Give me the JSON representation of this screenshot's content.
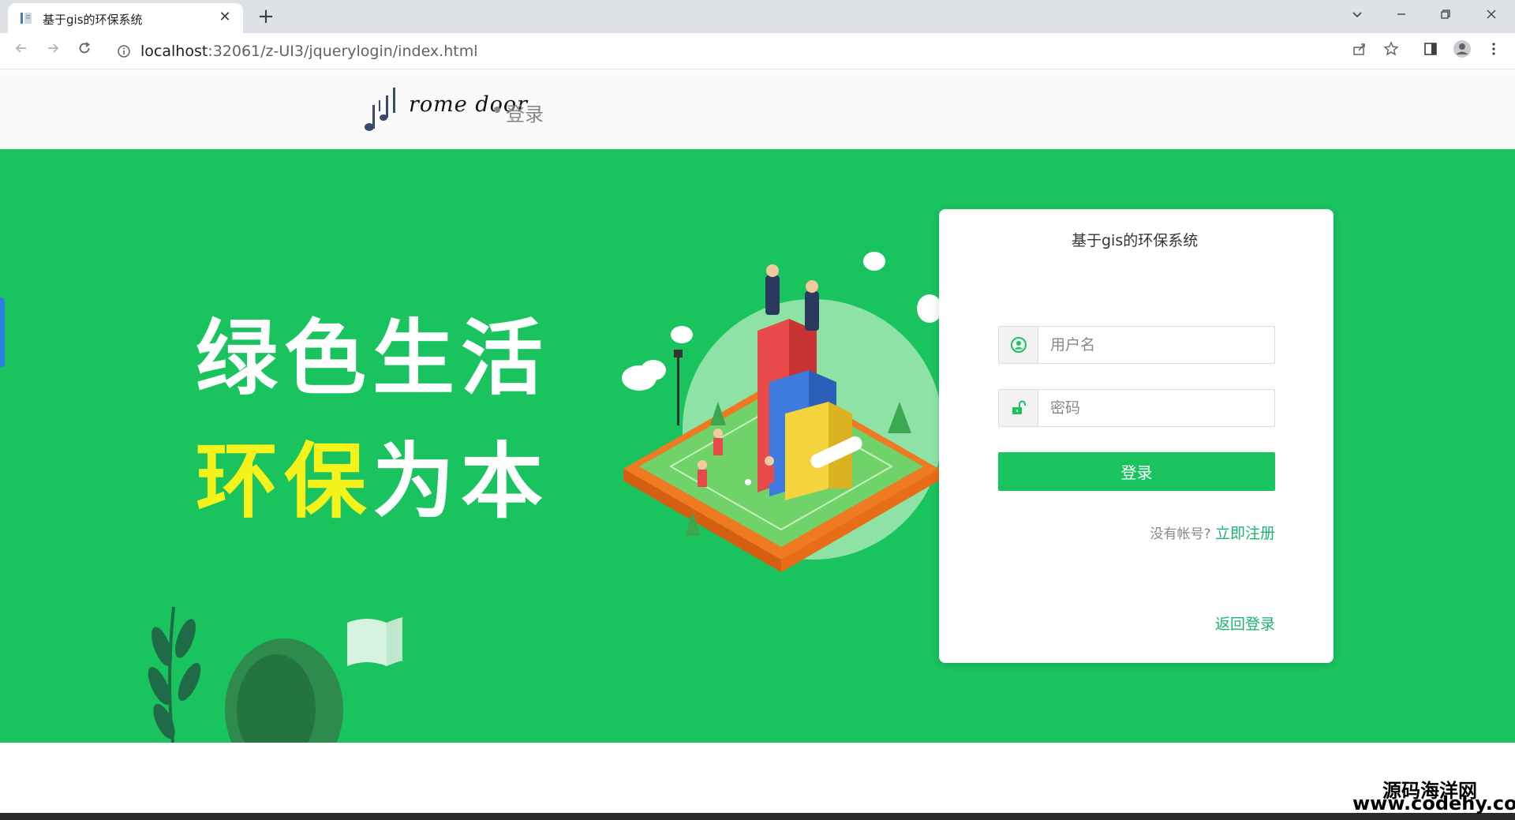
{
  "browser": {
    "tab_title": "基于gis的环保系统",
    "tab_close": "✕",
    "new_tab": "+",
    "url_host": "localhost",
    "url_path": ":32061/z-UI3/jquerylogin/index.html"
  },
  "header": {
    "logo_text": "rome door",
    "subtitle": "登录"
  },
  "hero": {
    "line1": "绿色生活",
    "line2_yellow": "环保",
    "line2_white": "为本"
  },
  "login": {
    "system_title": "基于gis的环保系统",
    "username_placeholder": "用户名",
    "password_placeholder": "密码",
    "login_button": "登录",
    "no_account_text": "没有帐号?",
    "register_link": "立即注册",
    "back_link": "返回登录"
  },
  "watermark": {
    "line1": "源码海洋网",
    "line2": "www.codehy.com"
  },
  "colors": {
    "brand_green": "#19c35e",
    "link_green": "#19b36f",
    "slogan_yellow": "#f6f21c"
  }
}
